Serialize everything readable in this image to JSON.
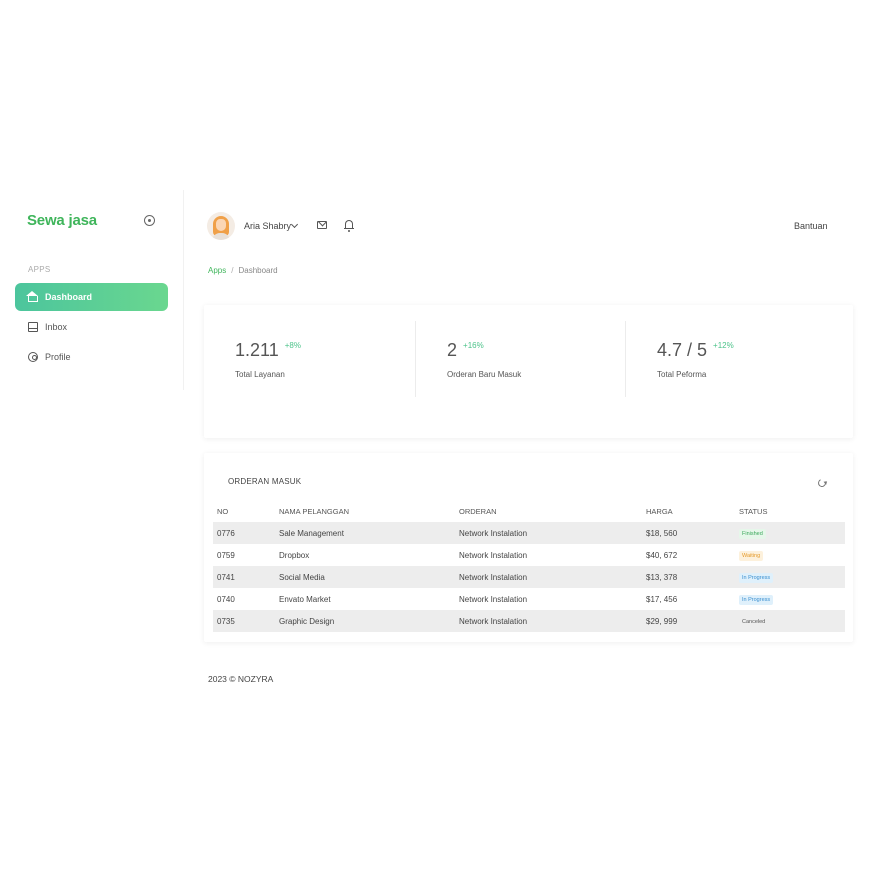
{
  "sidebar": {
    "brand": "Sewa jasa",
    "section_label": "APPS",
    "items": [
      {
        "label": "Dashboard",
        "icon": "home-icon",
        "active": true
      },
      {
        "label": "Inbox",
        "icon": "inbox-icon",
        "active": false
      },
      {
        "label": "Profile",
        "icon": "profile-icon",
        "active": false
      }
    ]
  },
  "header": {
    "user_name": "Aria Shabry",
    "help_label": "Bantuan"
  },
  "breadcrumb": {
    "root": "Apps",
    "separator": "/",
    "current": "Dashboard"
  },
  "stats": [
    {
      "value": "1.211",
      "delta": "+8%",
      "label": "Total Layanan"
    },
    {
      "value": "2",
      "delta": "+16%",
      "label": "Orderan Baru Masuk"
    },
    {
      "value": "4.7 / 5",
      "delta": "+12%",
      "label": "Total Peforma"
    }
  ],
  "orders": {
    "title": "ORDERAN MASUK",
    "columns": [
      "NO",
      "NAMA PELANGGAN",
      "ORDERAN",
      "HARGA",
      "STATUS"
    ],
    "rows": [
      {
        "no": "0776",
        "customer": "Sale Management",
        "order": "Network Instalation",
        "price": "$18, 560",
        "status": "Finished"
      },
      {
        "no": "0759",
        "customer": "Dropbox",
        "order": "Network Instalation",
        "price": "$40, 672",
        "status": "Waiting"
      },
      {
        "no": "0741",
        "customer": "Social Media",
        "order": "Network Instalation",
        "price": "$13, 378",
        "status": "In Progress"
      },
      {
        "no": "0740",
        "customer": "Envato Market",
        "order": "Network Instalation",
        "price": "$17, 456",
        "status": "In Progress"
      },
      {
        "no": "0735",
        "customer": "Graphic Design",
        "order": "Network Instalation",
        "price": "$29, 999",
        "status": "Canceled"
      }
    ]
  },
  "footer": {
    "text": "2023 © NOZYRA"
  },
  "colors": {
    "brand": "#3fb55b",
    "active_nav_start": "#4cc59d",
    "active_nav_end": "#6ad78f",
    "delta_positive": "#4cc38a"
  }
}
